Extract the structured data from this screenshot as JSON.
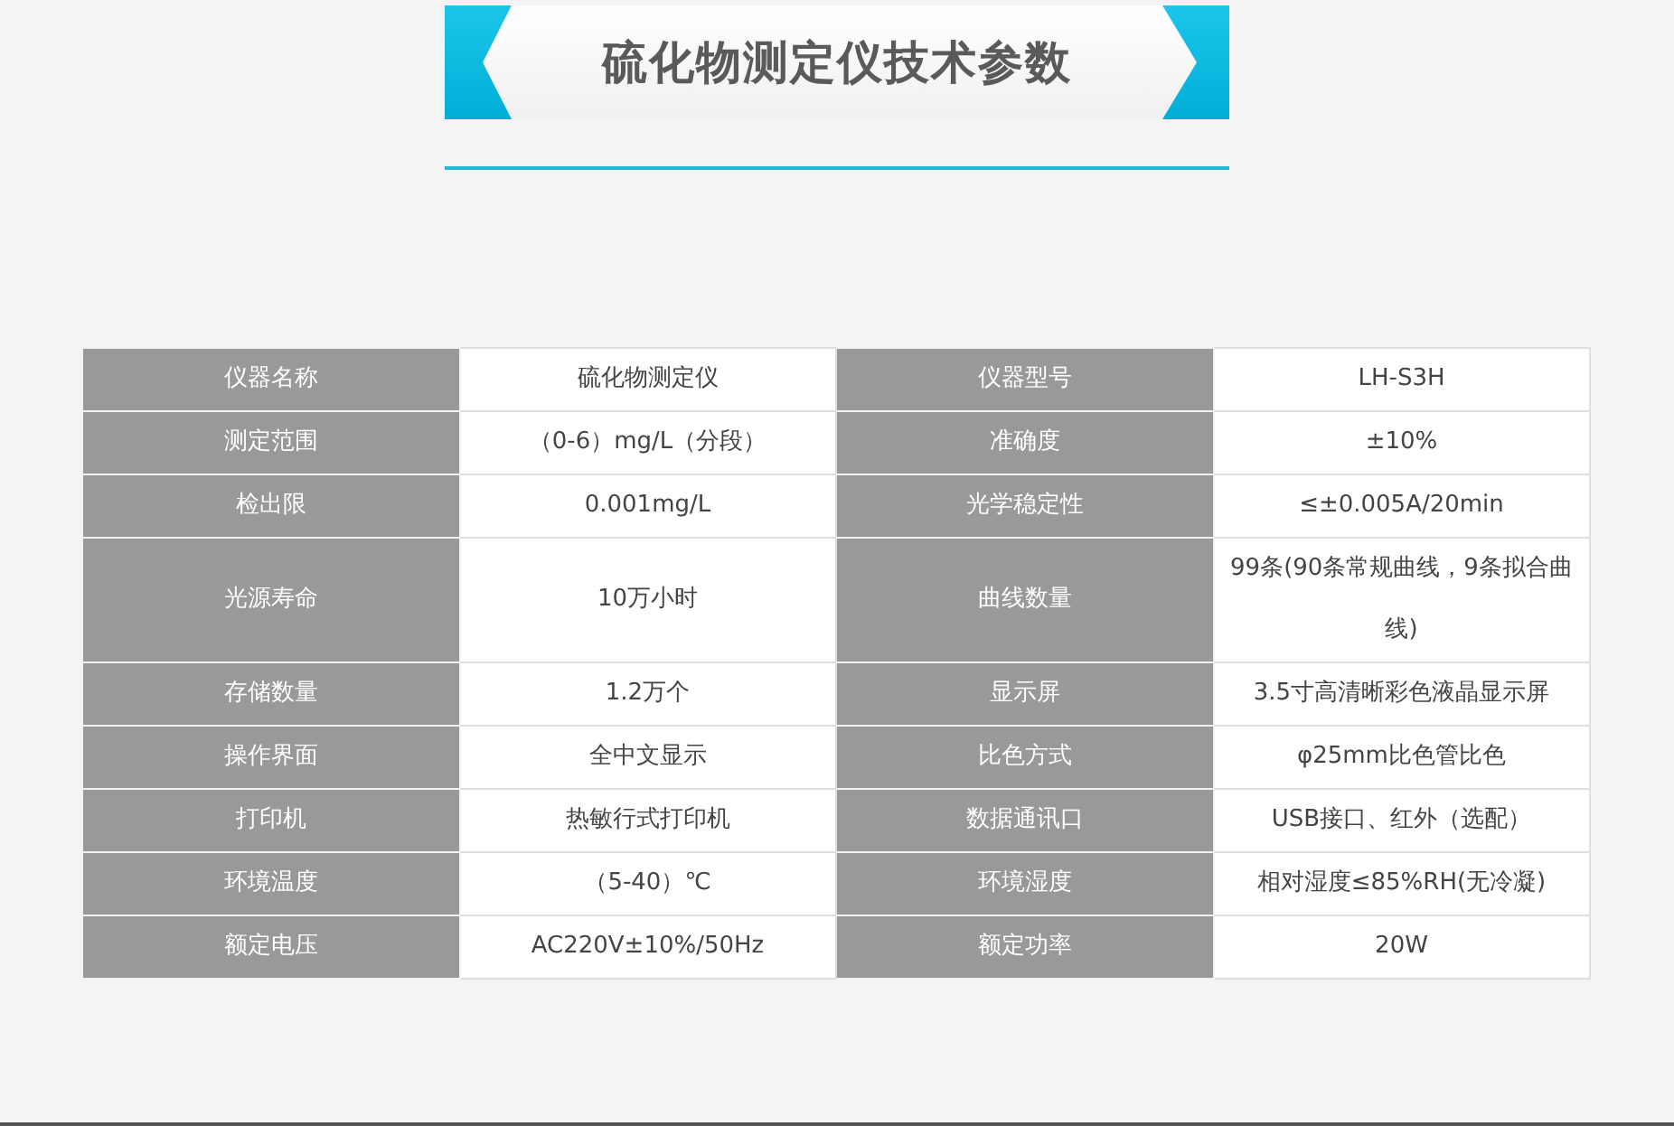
{
  "title": "硫化物测定仪技术参数",
  "table": {
    "rows": [
      {
        "cells": [
          "仪器名称",
          "硫化物测定仪",
          "仪器型号",
          "LH-S3H"
        ]
      },
      {
        "cells": [
          "测定范围",
          "（0-6）mg/L（分段）",
          "准确度",
          "±10%"
        ]
      },
      {
        "cells": [
          "检出限",
          "0.001mg/L",
          "光学稳定性",
          "≤±0.005A/20min"
        ]
      },
      {
        "cells": [
          "光源寿命",
          "10万小时",
          "曲线数量",
          "99条(90条常规曲线，9条拟合曲线)"
        ]
      },
      {
        "cells": [
          "存储数量",
          "1.2万个",
          "显示屏",
          "3.5寸高清晰彩色液晶显示屏"
        ]
      },
      {
        "cells": [
          "操作界面",
          "全中文显示",
          "比色方式",
          "φ25mm比色管比色"
        ]
      },
      {
        "cells": [
          "打印机",
          "热敏行式打印机",
          "数据通讯口",
          "USB接口、红外（选配）"
        ]
      },
      {
        "cells": [
          "环境温度",
          "（5-40）℃",
          "环境湿度",
          "相对湿度≤85%RH(无冷凝)"
        ]
      },
      {
        "cells": [
          "额定电压",
          "AC220V±10%/50Hz",
          "额定功率",
          "20W"
        ]
      }
    ]
  }
}
